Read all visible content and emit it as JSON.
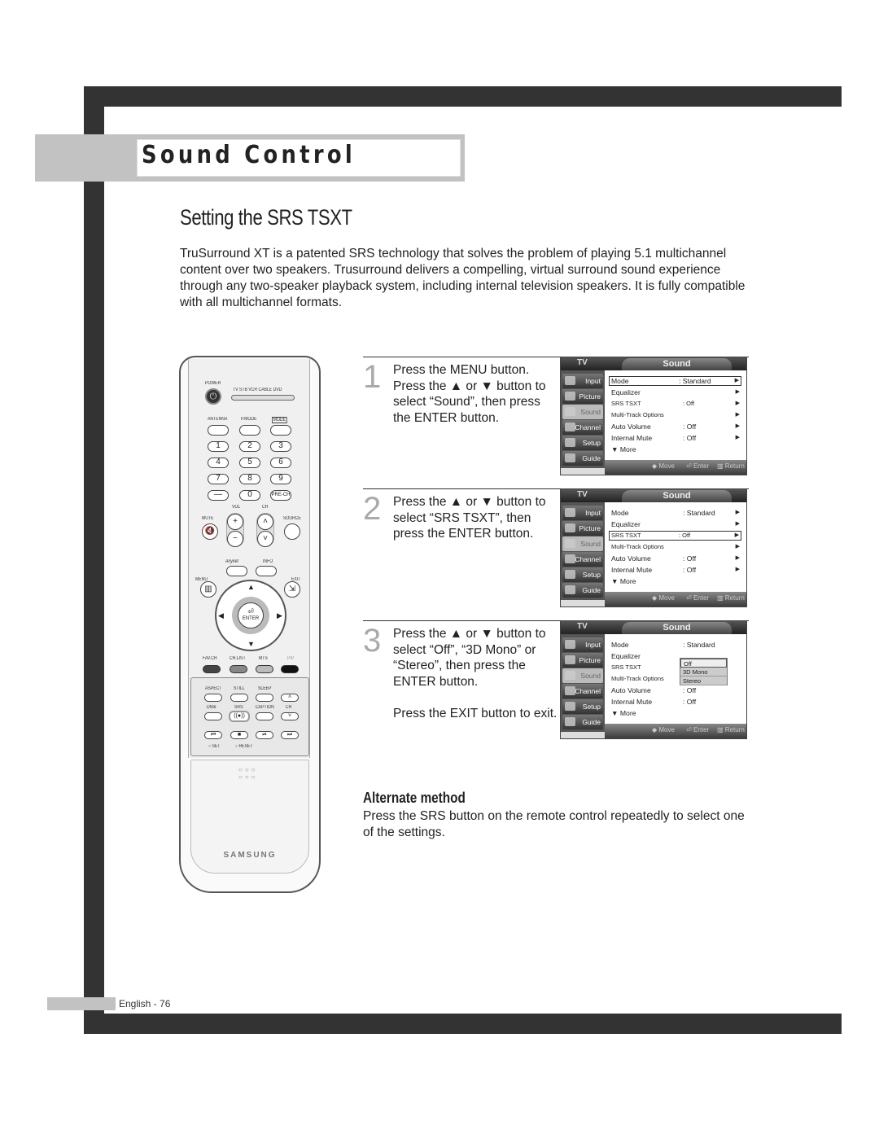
{
  "header": {
    "section_title": "Sound Control",
    "subtitle": "Setting the SRS TSXT"
  },
  "intro": "TruSurround XT is a patented SRS technology that solves the problem of playing 5.1 multichannel content over two speakers. Trusurround delivers a compelling, virtual surround sound experience through any two-speaker playback system, including internal television speakers. It is fully compatible with all multichannel formats.",
  "remote": {
    "power_label": "POWER",
    "device_modes": "TV  STB  VCR  CABLE  DVD",
    "antenna": "ANTENNA",
    "pmode": "P.MODE",
    "mode": "MODE",
    "digits": [
      "1",
      "2",
      "3",
      "4",
      "5",
      "6",
      "7",
      "8",
      "9",
      "—",
      "0",
      "PRE-CH"
    ],
    "vol": "VOL",
    "ch": "CH",
    "mute": "MUTE",
    "source": "SOURCE",
    "anynet": "Anynet",
    "info": "INFO",
    "menu": "MENU",
    "exit": "EXIT",
    "enter": "ENTER",
    "favch": "FAV.CH",
    "chlist": "CH.LIST",
    "mts": "MTS",
    "pip": "PIP",
    "aspect": "ASPECT",
    "still": "STILL",
    "sleep": "SLEEP",
    "dnie": "DNIe",
    "srs": "SRS",
    "caption": "CAPTION",
    "set": "SET",
    "reset": "RESET",
    "brand": "SAMSUNG"
  },
  "osd_common": {
    "tv": "TV",
    "title": "Sound",
    "side": [
      "Input",
      "Picture",
      "Sound",
      "Channel",
      "Setup",
      "Guide"
    ],
    "footer": [
      "◆ Move",
      "Enter",
      "Return"
    ]
  },
  "steps": [
    {
      "num": "1",
      "text": "Press the MENU button. Press the ▲ or ▼ button to select “Sound”, then press the ENTER button.",
      "menu": [
        {
          "label": "Mode",
          "value": ": Standard",
          "arrow": "▶"
        },
        {
          "label": "Equalizer",
          "value": "",
          "arrow": "▶"
        },
        {
          "label": "SRS TSXT",
          "value": ": Off",
          "arrow": "▶"
        },
        {
          "label": "Multi-Track Options",
          "value": "",
          "arrow": "▶"
        },
        {
          "label": "Auto Volume",
          "value": ": Off",
          "arrow": "▶"
        },
        {
          "label": "Internal Mute",
          "value": ": Off",
          "arrow": "▶"
        },
        {
          "label": "▼ More",
          "value": "",
          "arrow": ""
        }
      ]
    },
    {
      "num": "2",
      "text": "Press the ▲ or ▼ button to select “SRS TSXT”, then press the ENTER button.",
      "menu": [
        {
          "label": "Mode",
          "value": ": Standard",
          "arrow": "▶"
        },
        {
          "label": "Equalizer",
          "value": "",
          "arrow": "▶"
        },
        {
          "label": "SRS TSXT",
          "value": ": Off",
          "arrow": "▶"
        },
        {
          "label": "Multi-Track Options",
          "value": "",
          "arrow": "▶"
        },
        {
          "label": "Auto Volume",
          "value": ": Off",
          "arrow": "▶"
        },
        {
          "label": "Internal Mute",
          "value": ": Off",
          "arrow": "▶"
        },
        {
          "label": "▼ More",
          "value": "",
          "arrow": ""
        }
      ]
    },
    {
      "num": "3",
      "text": "Press the ▲ or ▼ button to select “Off”, “3D Mono” or “Stereo”, then press the ENTER button.",
      "extra": "Press the EXIT button to exit.",
      "menu": [
        {
          "label": "Mode",
          "value": ": Standard",
          "arrow": ""
        },
        {
          "label": "Equalizer",
          "value": "",
          "arrow": ""
        },
        {
          "label": "SRS TSXT",
          "value": "",
          "arrow": ""
        },
        {
          "label": "Multi-Track Options",
          "value": "",
          "arrow": ""
        },
        {
          "label": "Auto Volume",
          "value": ": Off",
          "arrow": ""
        },
        {
          "label": "Internal Mute",
          "value": ": Off",
          "arrow": ""
        },
        {
          "label": "▼ More",
          "value": "",
          "arrow": ""
        }
      ],
      "dropdown": [
        "Off",
        "3D Mono",
        "Stereo"
      ]
    }
  ],
  "alternate": {
    "title": "Alternate method",
    "text": "Press the SRS button on the remote control repeatedly to select one of the settings."
  },
  "footer": {
    "page": "English - 76"
  }
}
